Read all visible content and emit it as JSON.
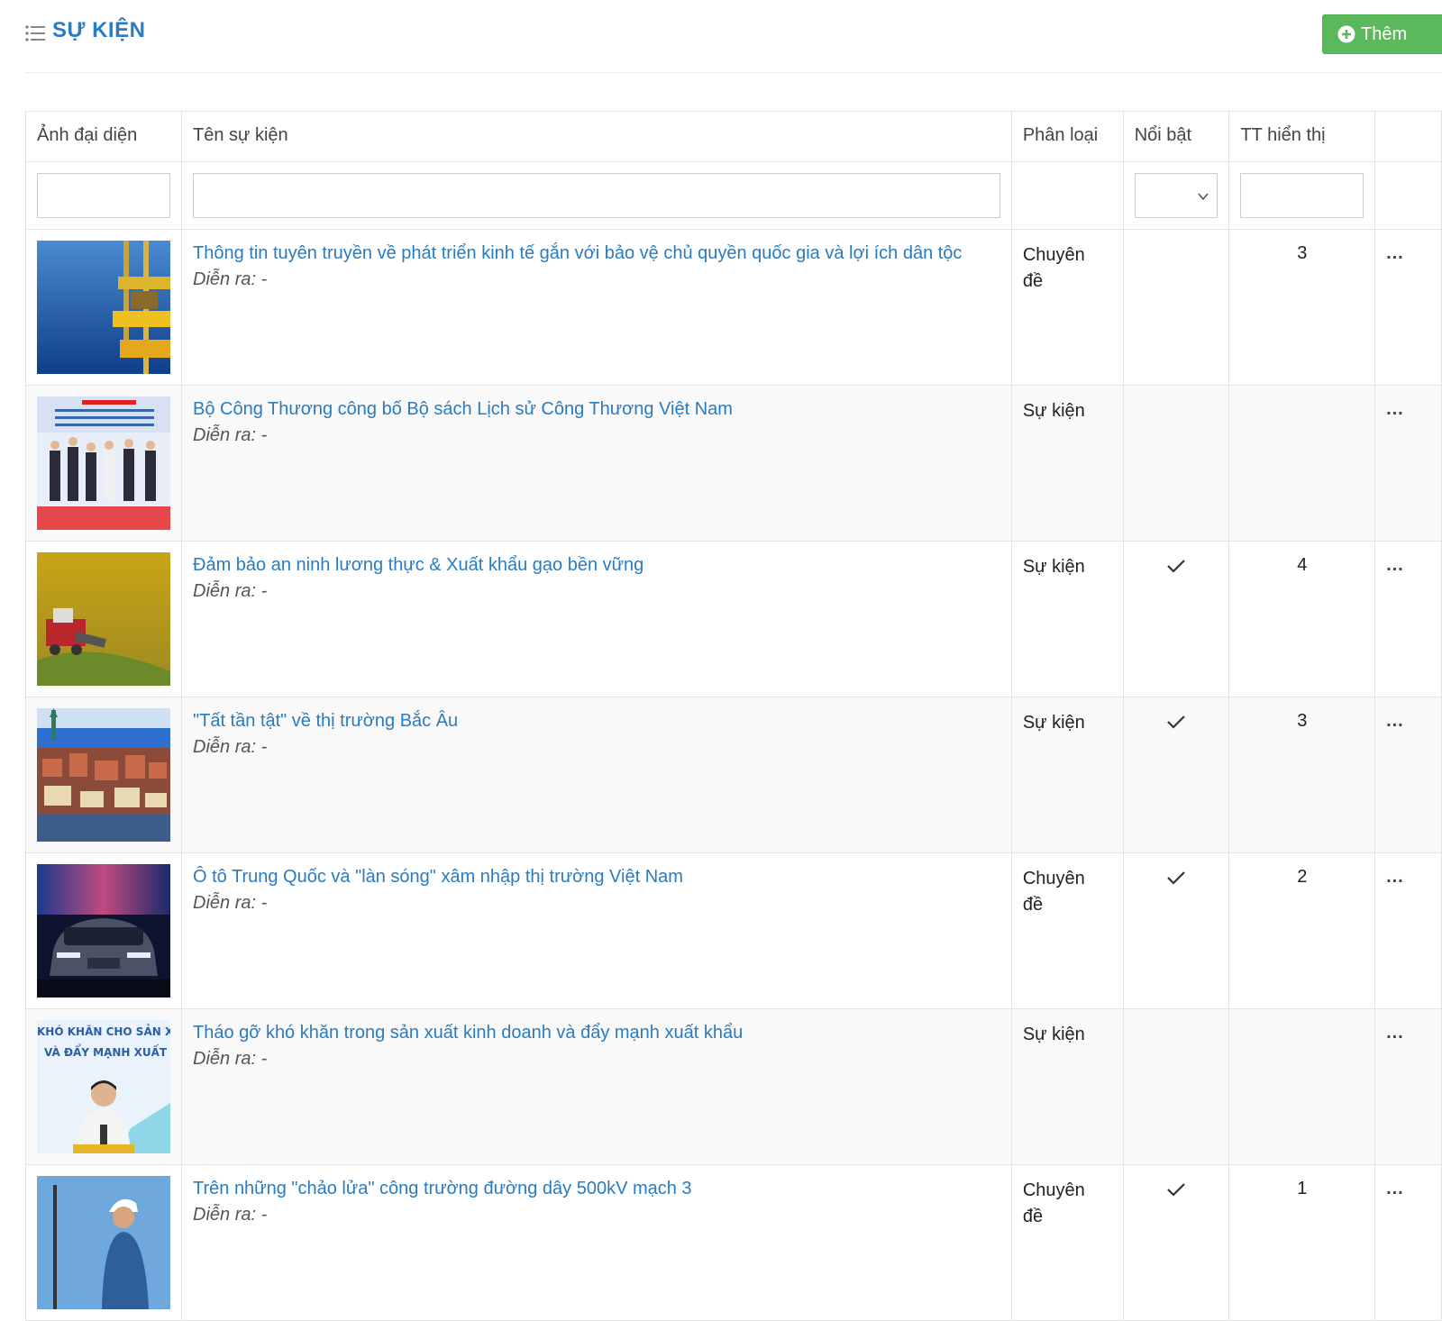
{
  "header": {
    "title": "SỰ KIỆN",
    "add_label": "Thêm"
  },
  "columns": {
    "thumbnail": "Ảnh đại diện",
    "name": "Tên sự kiện",
    "category": "Phân loại",
    "featured": "Nổi bật",
    "order": "TT hiển thị"
  },
  "filters": {
    "thumbnail": "",
    "name": "",
    "featured": "",
    "order": ""
  },
  "rows": [
    {
      "title": "Thông tin tuyên truyền về phát triển kinh tế gắn với bảo vệ chủ quyền quốc gia và lợi ích dân tộc",
      "time_label": "Diễn ra: -",
      "category_line1": "Chuyên",
      "category_line2": "đề",
      "featured": false,
      "order": "3",
      "actions": "...",
      "thumb_icon": "offshore-rig-image"
    },
    {
      "title": "Bộ Công Thương công bố Bộ sách Lịch sử Công Thương Việt Nam",
      "time_label": "Diễn ra: -",
      "category_line1": "Sự kiện",
      "category_line2": "",
      "featured": false,
      "order": "",
      "actions": "...",
      "thumb_icon": "ceremony-image"
    },
    {
      "title": "Đảm bảo an ninh lương thực & Xuất khẩu gạo bền vững",
      "time_label": "Diễn ra: -",
      "category_line1": "Sự kiện",
      "category_line2": "",
      "featured": true,
      "order": "4",
      "actions": "...",
      "thumb_icon": "rice-field-image"
    },
    {
      "title": "\"Tất tần tật\" về thị trường Bắc Âu",
      "time_label": "Diễn ra: -",
      "category_line1": "Sự kiện",
      "category_line2": "",
      "featured": true,
      "order": "3",
      "actions": "...",
      "thumb_icon": "city-image"
    },
    {
      "title": "Ô tô Trung Quốc và \"làn sóng\" xâm nhập thị trường Việt Nam",
      "time_label": "Diễn ra: -",
      "category_line1": "Chuyên",
      "category_line2": "đề",
      "featured": true,
      "order": "2",
      "actions": "...",
      "thumb_icon": "car-image"
    },
    {
      "title": "Tháo gỡ khó khăn trong sản xuất kinh doanh và đẩy mạnh xuất khẩu",
      "time_label": "Diễn ra: -",
      "category_line1": "Sự kiện",
      "category_line2": "",
      "featured": false,
      "order": "",
      "actions": "...",
      "thumb_icon": "speaker-image",
      "thumb_text1": "KHÓ KHĂN CHO SẢN XI",
      "thumb_text2": "VÀ ĐẨY MẠNH XUẤT"
    },
    {
      "title": "Trên những \"chảo lửa\" công trường đường dây 500kV mạch 3",
      "time_label": "Diễn ra: -",
      "category_line1": "Chuyên",
      "category_line2": "đề",
      "featured": true,
      "order": "1",
      "actions": "...",
      "thumb_icon": "worker-image"
    }
  ],
  "colors": {
    "accent": "#2a7bbf",
    "success": "#5cb85c",
    "border": "#e3e3e3"
  }
}
